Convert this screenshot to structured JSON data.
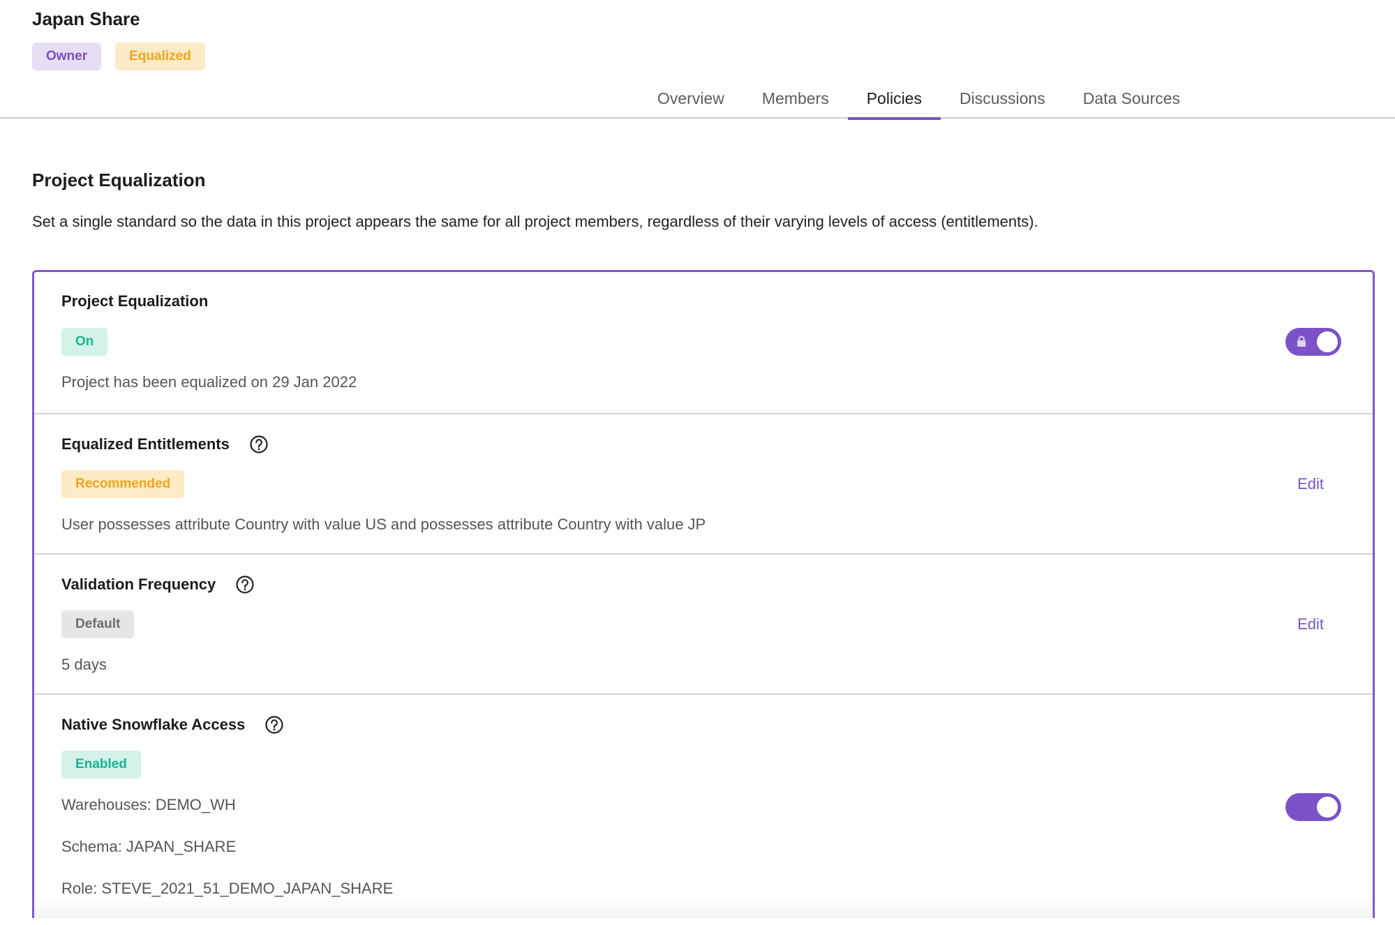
{
  "project": {
    "title": "Japan Share",
    "badges": {
      "owner": "Owner",
      "equalized": "Equalized"
    }
  },
  "tabs": [
    {
      "label": "Overview"
    },
    {
      "label": "Members"
    },
    {
      "label": "Policies",
      "active": true
    },
    {
      "label": "Discussions"
    },
    {
      "label": "Data Sources"
    }
  ],
  "section": {
    "title": "Project Equalization",
    "description": "Set a single standard so the data in this project appears the same for all project members, regardless of their varying levels of access (entitlements)."
  },
  "rows": {
    "equalization": {
      "title": "Project Equalization",
      "tag": "On",
      "text": "Project has been equalized on 29 Jan 2022",
      "toggle": {
        "on": true,
        "locked": true,
        "icon": "lock-icon"
      }
    },
    "entitlements": {
      "title": "Equalized Entitlements",
      "tag": "Recommended",
      "text": "User possesses attribute Country with value US and possesses attribute Country with value JP",
      "edit_label": "Edit"
    },
    "validation": {
      "title": "Validation Frequency",
      "tag": "Default",
      "text": "5 days",
      "edit_label": "Edit"
    },
    "snowflake": {
      "title": "Native Snowflake Access",
      "tag": "Enabled",
      "warehouses": "Warehouses: DEMO_WH",
      "schema": "Schema: JAPAN_SHARE",
      "role": "Role: STEVE_2021_51_DEMO_JAPAN_SHARE",
      "toggle": {
        "on": true,
        "locked": false
      }
    }
  },
  "colors": {
    "accent": "#7b52c8",
    "owner_bg": "#e6dff3",
    "equalized_bg": "#fdebc5",
    "enabled_bg": "#d3f2ea",
    "enabled_fg": "#1bb592",
    "warning_fg": "#f0a41e"
  },
  "icons": {
    "help": "question-circle-icon",
    "lock": "lock-icon"
  }
}
